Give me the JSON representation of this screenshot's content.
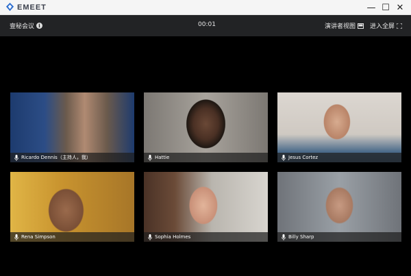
{
  "window": {
    "brand": "EMEET",
    "controls": {
      "minimize": "—",
      "maximize": "☐",
      "close": "✕"
    }
  },
  "toolbar": {
    "meeting_title": "壹秘会议",
    "timer": "00:01",
    "speaker_view_label": "演讲者视图",
    "fullscreen_label": "进入全屏"
  },
  "participants": [
    {
      "name": "Ricardo Dennis（主持人，我）",
      "bg": "#6b5a4c"
    },
    {
      "name": "Hattie",
      "bg": "#8a8682"
    },
    {
      "name": "Jesus Cortez",
      "bg": "#c9c2bb"
    },
    {
      "name": "Rena Simpson",
      "bg": "#c79a3a"
    },
    {
      "name": "Sophia Holmes",
      "bg": "#9e9c98"
    },
    {
      "name": "Billy Sharp",
      "bg": "#8b8f94"
    }
  ]
}
